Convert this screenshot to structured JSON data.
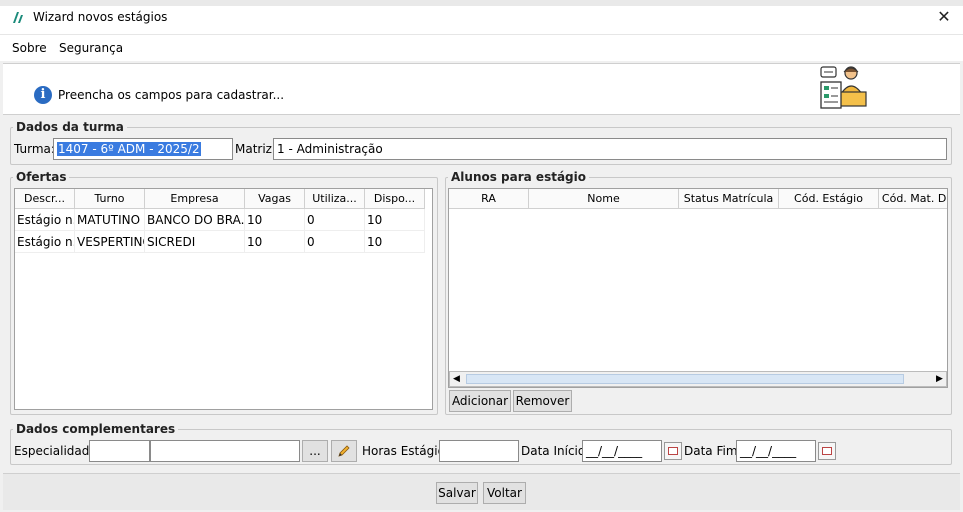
{
  "window": {
    "title": "Wizard novos estágios",
    "close_glyph": "✕"
  },
  "menu": {
    "items": [
      "Sobre",
      "Segurança"
    ]
  },
  "header": {
    "message": "Preencha os campos para cadastrar...",
    "info_glyph": "i"
  },
  "dados_turma": {
    "legend": "Dados da turma",
    "turma_label": "Turma:",
    "turma_value": "1407 - 6º ADM - 2025/2",
    "matriz_label": "Matriz:",
    "matriz_value": "1 - Administração"
  },
  "ofertas": {
    "legend": "Ofertas",
    "columns": [
      "Descr...",
      "Turno",
      "Empresa",
      "Vagas",
      "Utiliza...",
      "Dispo..."
    ],
    "rows": [
      [
        "Estágio n...",
        "MATUTINO",
        "BANCO DO BRA...",
        "10",
        "0",
        "10"
      ],
      [
        "Estágio n...",
        "VESPERTINO",
        "SICREDI",
        "10",
        "0",
        "10"
      ]
    ]
  },
  "alunos": {
    "legend": "Alunos para estágio",
    "columns": [
      "RA",
      "Nome",
      "Status Matrícula",
      "Cód. Estágio",
      "Cód. Mat. Dis"
    ],
    "add_label": "Adicionar",
    "remove_label": "Remover"
  },
  "complementares": {
    "legend": "Dados complementares",
    "especialidade_label": "Especialidade:",
    "especialidade_code": "",
    "especialidade_desc": "",
    "browse_label": "...",
    "horas_label": "Horas Estágio:",
    "horas_value": "",
    "data_inicio_label": "Data Início:",
    "data_inicio_value": "__/__/____",
    "data_fim_label": "Data Fim:",
    "data_fim_value": "__/__/____"
  },
  "footer": {
    "save_label": "Salvar",
    "back_label": "Voltar"
  },
  "colors": {
    "accent": "#3a7be0",
    "info": "#2a6bc2"
  }
}
